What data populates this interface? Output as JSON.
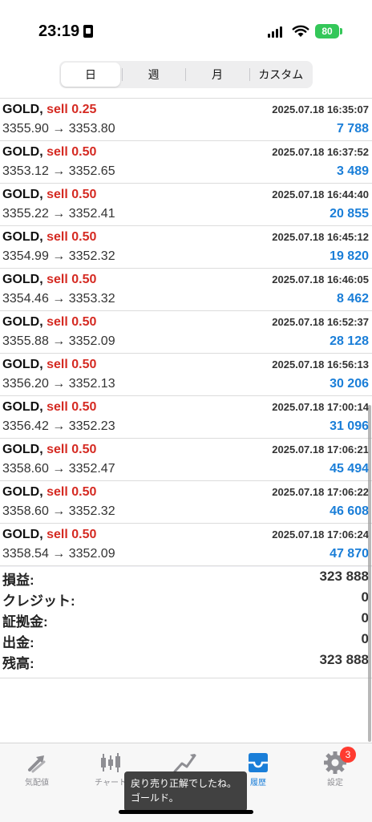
{
  "status_bar": {
    "time": "23:19",
    "battery": "80"
  },
  "segments": [
    {
      "label": "日",
      "active": true
    },
    {
      "label": "週",
      "active": false
    },
    {
      "label": "月",
      "active": false
    },
    {
      "label": "カスタム",
      "active": false
    }
  ],
  "trades": [
    {
      "symbol": "GOLD,",
      "side": "sell 0.25",
      "datetime": "2025.07.18 16:35:07",
      "open": "3355.90",
      "arrow": "→",
      "close": "3353.80",
      "profit": "7 788"
    },
    {
      "symbol": "GOLD,",
      "side": "sell 0.50",
      "datetime": "2025.07.18 16:37:52",
      "open": "3353.12",
      "arrow": "→",
      "close": "3352.65",
      "profit": "3 489"
    },
    {
      "symbol": "GOLD,",
      "side": "sell 0.50",
      "datetime": "2025.07.18 16:44:40",
      "open": "3355.22",
      "arrow": "→",
      "close": "3352.41",
      "profit": "20 855"
    },
    {
      "symbol": "GOLD,",
      "side": "sell 0.50",
      "datetime": "2025.07.18 16:45:12",
      "open": "3354.99",
      "arrow": "→",
      "close": "3352.32",
      "profit": "19 820"
    },
    {
      "symbol": "GOLD,",
      "side": "sell 0.50",
      "datetime": "2025.07.18 16:46:05",
      "open": "3354.46",
      "arrow": "→",
      "close": "3353.32",
      "profit": "8 462"
    },
    {
      "symbol": "GOLD,",
      "side": "sell 0.50",
      "datetime": "2025.07.18 16:52:37",
      "open": "3355.88",
      "arrow": "→",
      "close": "3352.09",
      "profit": "28 128"
    },
    {
      "symbol": "GOLD,",
      "side": "sell 0.50",
      "datetime": "2025.07.18 16:56:13",
      "open": "3356.20",
      "arrow": "→",
      "close": "3352.13",
      "profit": "30 206"
    },
    {
      "symbol": "GOLD,",
      "side": "sell 0.50",
      "datetime": "2025.07.18 17:00:14",
      "open": "3356.42",
      "arrow": "→",
      "close": "3352.23",
      "profit": "31 096"
    },
    {
      "symbol": "GOLD,",
      "side": "sell 0.50",
      "datetime": "2025.07.18 17:06:21",
      "open": "3358.60",
      "arrow": "→",
      "close": "3352.47",
      "profit": "45 494"
    },
    {
      "symbol": "GOLD,",
      "side": "sell 0.50",
      "datetime": "2025.07.18 17:06:22",
      "open": "3358.60",
      "arrow": "→",
      "close": "3352.32",
      "profit": "46 608"
    },
    {
      "symbol": "GOLD,",
      "side": "sell 0.50",
      "datetime": "2025.07.18 17:06:24",
      "open": "3358.54",
      "arrow": "→",
      "close": "3352.09",
      "profit": "47 870"
    }
  ],
  "summary": [
    {
      "label": "損益:",
      "value": "323 888"
    },
    {
      "label": "クレジット:",
      "value": "0"
    },
    {
      "label": "証拠金:",
      "value": "0"
    },
    {
      "label": "出金:",
      "value": "0"
    },
    {
      "label": "残高:",
      "value": "323 888"
    }
  ],
  "tabbar": [
    {
      "label": "気配値",
      "icon": "quotes-arrows-icon",
      "active": false
    },
    {
      "label": "チャート",
      "icon": "candlestick-icon",
      "active": false
    },
    {
      "label": "",
      "icon": "trade-chart-icon",
      "active": false
    },
    {
      "label": "履歴",
      "icon": "history-inbox-icon",
      "active": true
    },
    {
      "label": "設定",
      "icon": "gear-icon",
      "active": false,
      "badge": "3"
    }
  ],
  "toast": {
    "text": "戻り売り正解でしたね。ゴールド。"
  },
  "colors": {
    "sell": "#d52a22",
    "profit": "#1a7ed8",
    "active_tab": "#1a7ed8"
  }
}
